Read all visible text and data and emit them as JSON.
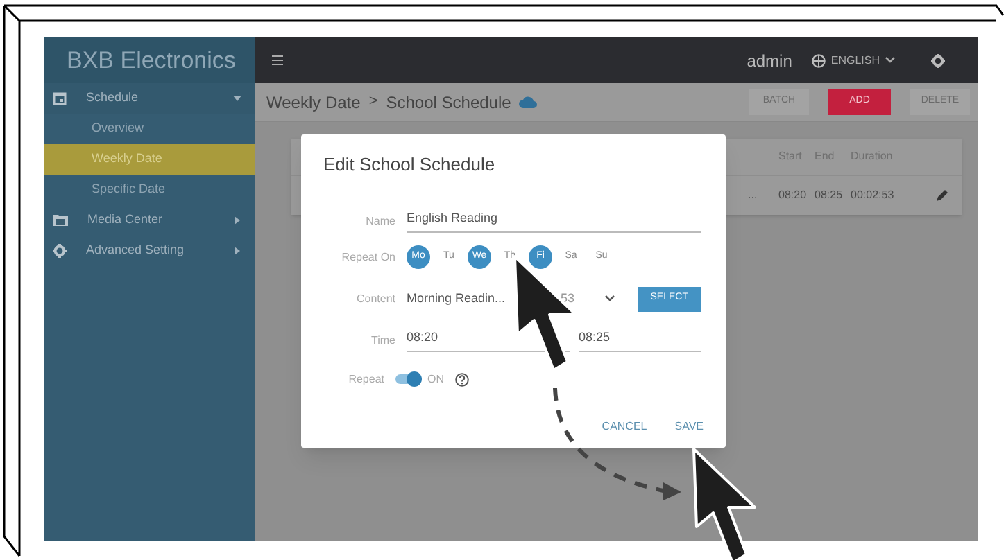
{
  "brand": "BXB Electronics",
  "sidebar": {
    "items": [
      {
        "label": "Schedule",
        "expanded": true,
        "children": [
          {
            "label": "Overview",
            "selected": false
          },
          {
            "label": "Weekly Date",
            "selected": true
          },
          {
            "label": "Specific Date",
            "selected": false
          }
        ]
      },
      {
        "label": "Media Center",
        "expanded": false
      },
      {
        "label": "Advanced Setting",
        "expanded": false
      }
    ]
  },
  "topbar": {
    "user": "admin",
    "language": "ENGLISH"
  },
  "breadcrumb": {
    "parent": "Weekly Date",
    "separator": ">",
    "current": "School Schedule"
  },
  "actions": [
    {
      "label": "BATCH",
      "disabled": true,
      "kind": "plain"
    },
    {
      "label": "ADD",
      "disabled": false,
      "kind": "primary"
    },
    {
      "label": "DELETE",
      "disabled": true,
      "kind": "plain"
    }
  ],
  "table": {
    "columns": [
      "Start",
      "End",
      "Duration"
    ],
    "rows": [
      {
        "column_1": "...",
        "start": "08:20",
        "end": "08:25",
        "duration": "00:02:53"
      }
    ]
  },
  "dialog": {
    "title": "Edit School Schedule",
    "name_label": "Name",
    "name_value": "English Reading",
    "repeat_on_label": "Repeat On",
    "days": [
      {
        "label": "Mo",
        "selected": true
      },
      {
        "label": "Tu",
        "selected": false
      },
      {
        "label": "We",
        "selected": true
      },
      {
        "label": "Th",
        "selected": false
      },
      {
        "label": "Fi",
        "selected": true
      },
      {
        "label": "Sa",
        "selected": false
      },
      {
        "label": "Su",
        "selected": false
      }
    ],
    "content_label": "Content",
    "content_value": "Morning Readin...",
    "content_extra": "53",
    "select_button": "SELECT",
    "time_label": "Time",
    "time_start": "08:20",
    "time_end": "08:25",
    "repeat_label": "Repeat",
    "repeat_on": true,
    "repeat_text": "ON",
    "buttons": [
      "CANCEL",
      "SAVE"
    ]
  }
}
